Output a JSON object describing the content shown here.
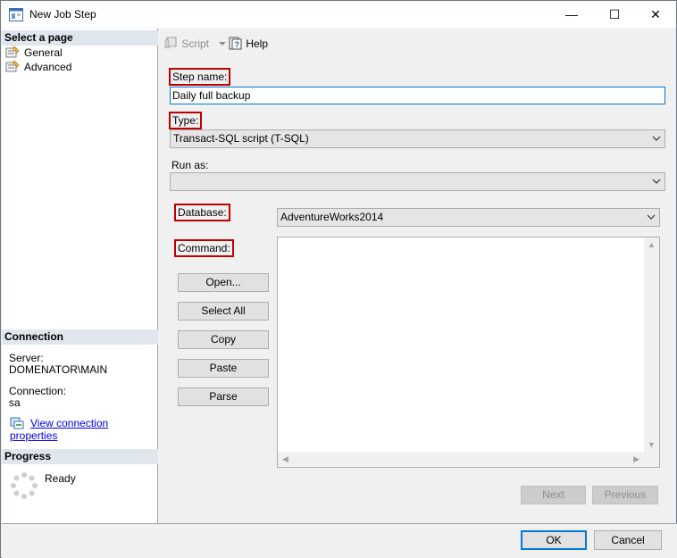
{
  "window": {
    "title": "New Job Step"
  },
  "titlebar": {
    "minimize_glyph": "—",
    "maximize_glyph": "☐",
    "close_glyph": "✕"
  },
  "left_pane": {
    "select_page_header": "Select a page",
    "pages": [
      {
        "label": "General",
        "icon": "general-page-icon"
      },
      {
        "label": "Advanced",
        "icon": "advanced-page-icon"
      }
    ],
    "connection_header": "Connection",
    "server_label": "Server:",
    "server_value": "DOMENATOR\\MAIN",
    "connection_label": "Connection:",
    "connection_value": "sa",
    "view_connection_link": "View connection properties",
    "progress_header": "Progress",
    "progress_status": "Ready"
  },
  "toolbar": {
    "script_label": "Script",
    "help_label": "Help"
  },
  "form": {
    "step_name_label": "Step name:",
    "step_name_value": "Daily full backup",
    "type_label": "Type:",
    "type_value": "Transact-SQL script (T-SQL)",
    "run_as_label": "Run as:",
    "run_as_value": "",
    "database_label": "Database:",
    "database_value": "AdventureWorks2014",
    "command_label": "Command:",
    "command_value": "",
    "buttons": {
      "open": "Open...",
      "select_all": "Select All",
      "copy": "Copy",
      "paste": "Paste",
      "parse": "Parse"
    },
    "next_label": "Next",
    "previous_label": "Previous"
  },
  "footer": {
    "ok_label": "OK",
    "cancel_label": "Cancel"
  },
  "colors": {
    "highlight_border": "#c00000",
    "section_header_bg": "#dfe6ee",
    "focus_border": "#0078d7",
    "link": "#0000ee"
  }
}
